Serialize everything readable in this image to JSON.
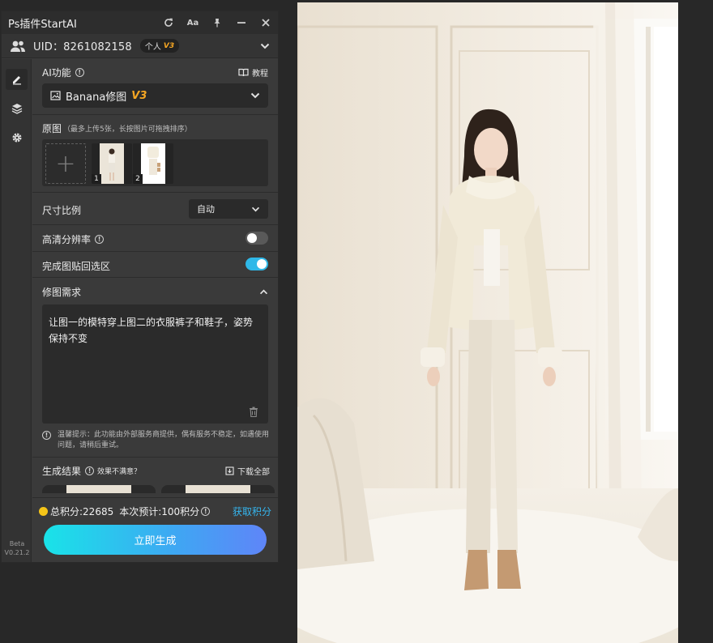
{
  "window": {
    "title": "Ps插件StartAI"
  },
  "user": {
    "uid": "UID：8261082158",
    "plan": "个人",
    "plan_version": "V3"
  },
  "ai_function": {
    "label": "AI功能",
    "tutorial": "教程",
    "selected": "Banana修图",
    "selected_version": "V3"
  },
  "source_images": {
    "label": "原图",
    "hint": "（最多上传5张，长按图片可拖拽排序）",
    "add_symbol": "+",
    "thumbs": [
      {
        "num": "1"
      },
      {
        "num": "2"
      }
    ]
  },
  "aspect_ratio": {
    "label": "尺寸比例",
    "value": "自动"
  },
  "hd_resolution": {
    "label": "高清分辨率",
    "enabled": false
  },
  "paste_back": {
    "label": "完成图贴回选区",
    "enabled": true
  },
  "edit_request": {
    "label": "修图需求",
    "text": "让图一的模特穿上图二的衣服裤子和鞋子，姿势保持不变",
    "notice": "温馨提示：此功能由外部服务商提供，偶有服务不稳定，如遇使用问题，请稍后重试。"
  },
  "results": {
    "label": "生成结果",
    "unsatisfied": "效果不满意？",
    "download_all": "下载全部"
  },
  "footer": {
    "total_points": "总积分:22685",
    "estimate": "本次预计:100积分",
    "get_points": "获取积分",
    "generate": "立即生成"
  },
  "version": {
    "line1": "Beta",
    "line2": "V0.21.2"
  },
  "colors": {
    "accent": "#2fb8e8",
    "gold": "#f5a623",
    "button_start": "#19e3e8",
    "button_end": "#5f85f8"
  }
}
